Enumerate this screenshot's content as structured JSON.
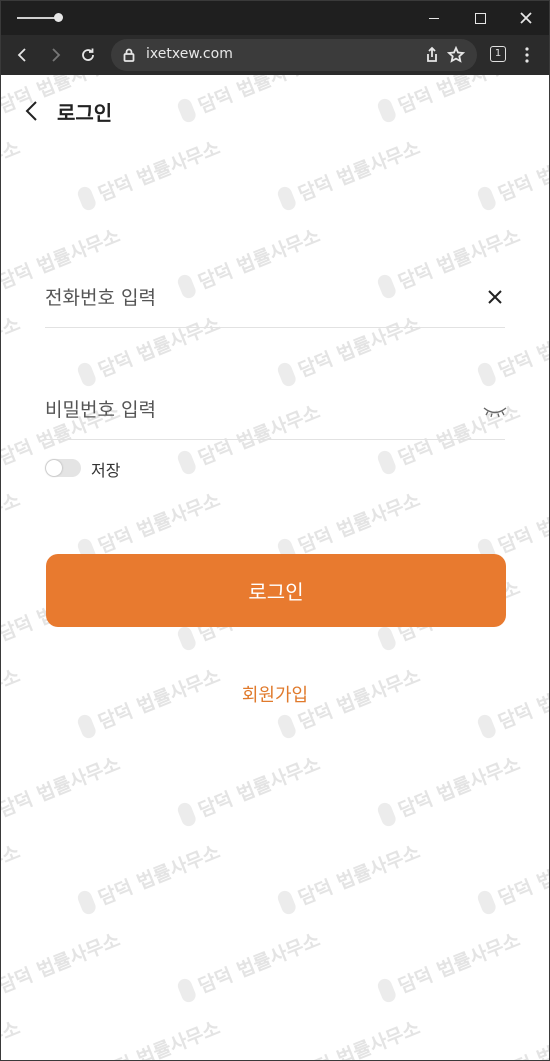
{
  "browser": {
    "url": "ixetxew.com",
    "tab_count": "1",
    "icons": [
      "back-arrow-icon",
      "forward-arrow-icon",
      "reload-icon",
      "lock-icon",
      "share-icon",
      "bookmark-star-icon",
      "menu-dots-icon"
    ]
  },
  "header": {
    "title": "로그인"
  },
  "form": {
    "phone_placeholder": "전화번호 입력",
    "password_placeholder": "비밀번호 입력",
    "save_label": "저장",
    "save_checked": false,
    "submit_label": "로그인",
    "signup_label": "회원가입"
  },
  "watermark": {
    "text": "담덕 법률사무소"
  },
  "colors": {
    "accent": "#e87a2f",
    "link": "#e07a2c",
    "titlebar": "#1f1f1f",
    "toolbar": "#2b2b2b"
  }
}
